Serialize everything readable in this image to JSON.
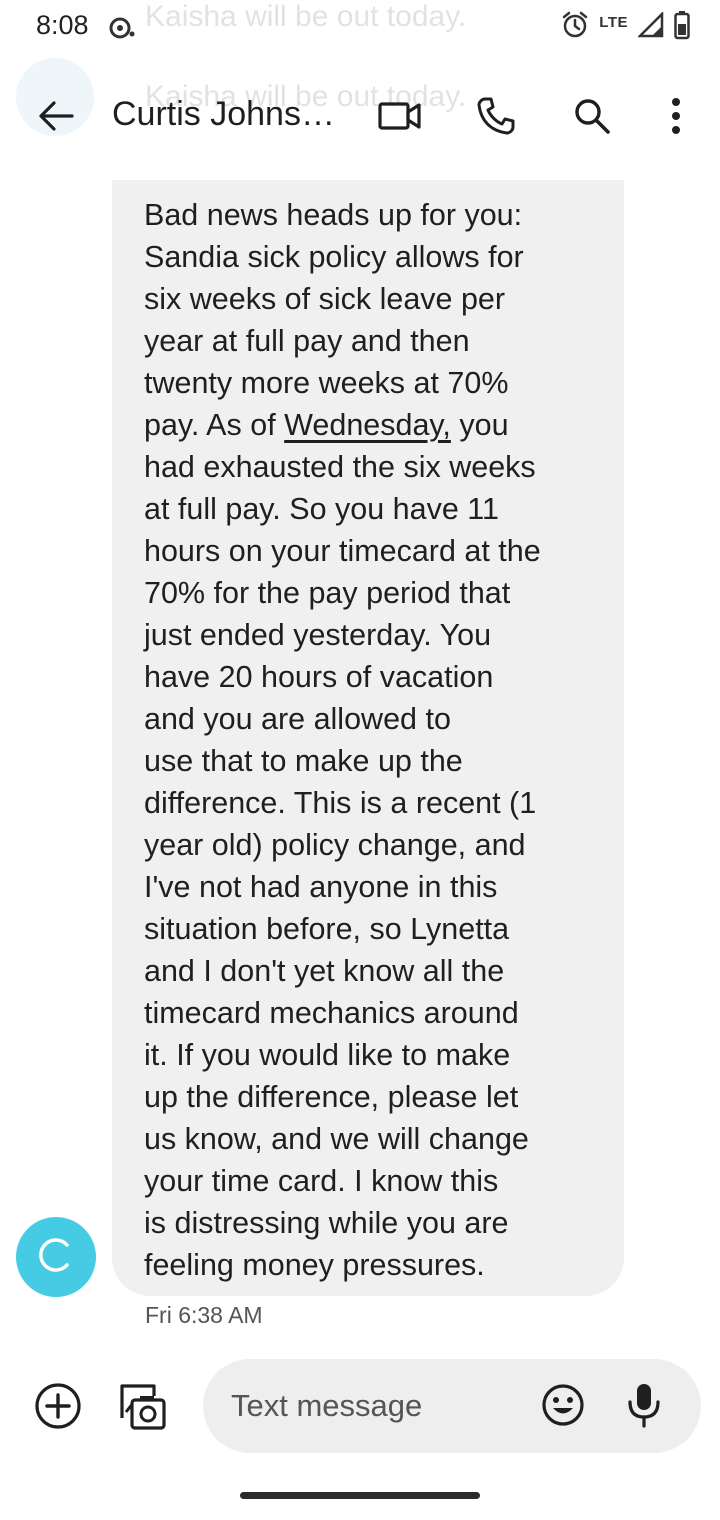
{
  "status_bar": {
    "time": "8:08",
    "network": "LTE"
  },
  "ghost_notifications": [
    "Kaisha will be out today.",
    "Kaisha will be out today."
  ],
  "app_bar": {
    "contact_name": "Curtis Johns…"
  },
  "message": {
    "lines": [
      "Bad news heads up for you:",
      "Sandia sick policy allows for",
      "six weeks of sick leave per",
      "year at full pay and then",
      "twenty more weeks at 70%",
      "pay.  As of ",
      "had exhausted the six weeks",
      "at full pay.  So you have 11",
      "hours on your timecard at the",
      "70% for the pay period that",
      "just ended yesterday.  You",
      "have 20 hours of vacation",
      "and you are allowed to",
      "use that to make up the",
      "difference.  This is a recent (1",
      "year old) policy change, and",
      "I've not had anyone in this",
      "situation before, so Lynetta",
      "and I don't yet know all the",
      "timecard mechanics around",
      "it.  If you would like to make",
      "up the difference, please let",
      "us know, and we will change",
      "your time card.  I know this",
      "is distressing while you are",
      "feeling money pressures."
    ],
    "link_text": "Wednesday,",
    "line6_tail": " you",
    "timestamp": "Fri 6:38 AM",
    "sender_initial": "C"
  },
  "compose": {
    "placeholder": "Text message"
  },
  "colors": {
    "avatar": "#46cbe4",
    "bubble": "#f0f0f0",
    "input": "#eeeeee"
  }
}
